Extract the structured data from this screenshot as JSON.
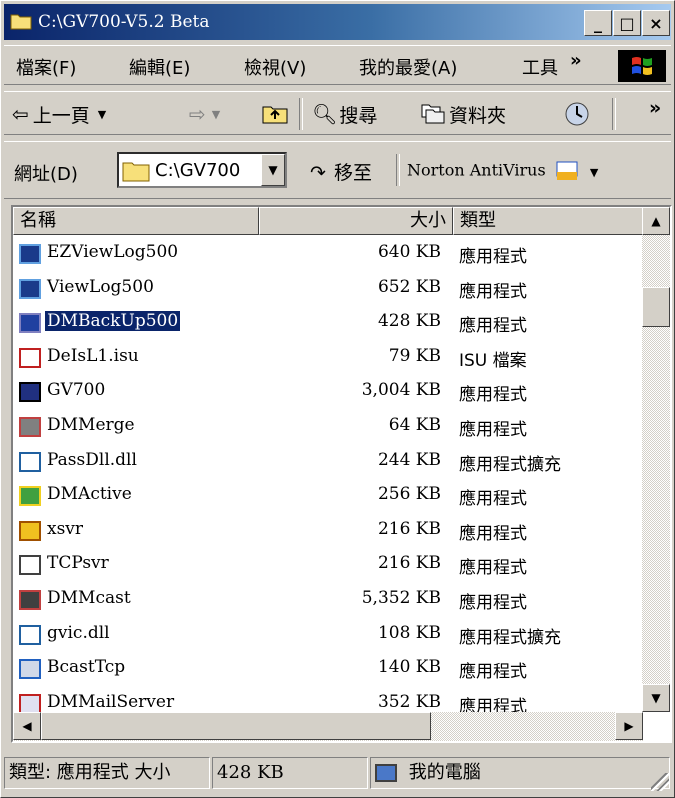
{
  "window": {
    "title": "C:\\GV700-V5.2 Beta"
  },
  "titlebar": {
    "minimize": "_",
    "maximize": "□",
    "close": "×"
  },
  "menu": [
    "檔案(F)",
    "編輯(E)",
    "檢視(V)",
    "我的最愛(A)",
    "工具"
  ],
  "menu_overflow": "»",
  "toolbar": {
    "back": "上一頁",
    "search": "搜尋",
    "folders": "資料夾",
    "overflow": "»"
  },
  "address": {
    "label": "網址(D)",
    "value": "C:\\GV700",
    "go": "移至",
    "links": "Norton AntiVirus"
  },
  "columns": {
    "name": "名稱",
    "size": "大小",
    "type": "類型"
  },
  "files": [
    {
      "name": "EZViewLog500",
      "size": "640 KB",
      "type": "應用程式",
      "icon": "app-window-icon"
    },
    {
      "name": "ViewLog500",
      "size": "652 KB",
      "type": "應用程式",
      "icon": "app-window-icon"
    },
    {
      "name": "DMBackUp500",
      "size": "428 KB",
      "type": "應用程式",
      "icon": "backup-app-icon",
      "selected": true
    },
    {
      "name": "DeIsL1.isu",
      "size": "79 KB",
      "type": "ISU 檔案",
      "icon": "isu-file-icon"
    },
    {
      "name": "GV700",
      "size": "3,004 KB",
      "type": "應用程式",
      "icon": "gv700-app-icon"
    },
    {
      "name": "DMMerge",
      "size": "64 KB",
      "type": "應用程式",
      "icon": "merge-app-icon"
    },
    {
      "name": "PassDll.dll",
      "size": "244 KB",
      "type": "應用程式擴充",
      "icon": "dll-file-icon"
    },
    {
      "name": "DMActive",
      "size": "256 KB",
      "type": "應用程式",
      "icon": "active-app-icon"
    },
    {
      "name": "xsvr",
      "size": "216 KB",
      "type": "應用程式",
      "icon": "xsvr-app-icon"
    },
    {
      "name": "TCPsvr",
      "size": "216 KB",
      "type": "應用程式",
      "icon": "tcp-server-icon"
    },
    {
      "name": "DMMcast",
      "size": "5,352 KB",
      "type": "應用程式",
      "icon": "mcast-app-icon"
    },
    {
      "name": "gvic.dll",
      "size": "108 KB",
      "type": "應用程式擴充",
      "icon": "dll-file-icon"
    },
    {
      "name": "BcastTcp",
      "size": "140 KB",
      "type": "應用程式",
      "icon": "magnifier-app-icon"
    },
    {
      "name": "DMMailServer",
      "size": "352 KB",
      "type": "應用程式",
      "icon": "mail-server-icon"
    }
  ],
  "status": {
    "type_info": "類型: 應用程式 大小",
    "size": "428 KB",
    "location": "我的電腦"
  }
}
